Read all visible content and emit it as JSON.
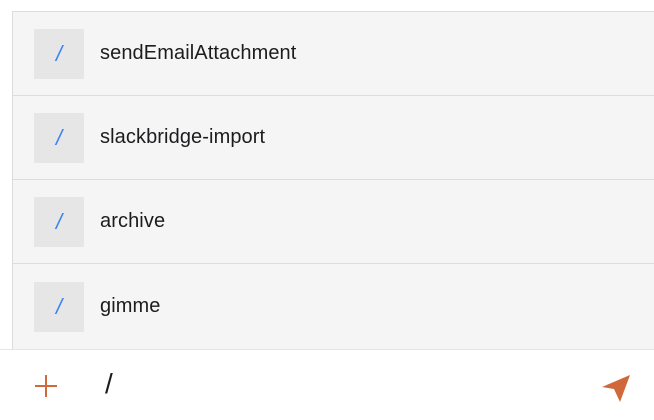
{
  "suggestions": {
    "items": [
      {
        "prefix": "/",
        "label": "sendEmailAttachment"
      },
      {
        "prefix": "/",
        "label": "slackbridge-import"
      },
      {
        "prefix": "/",
        "label": "archive"
      },
      {
        "prefix": "/",
        "label": "gimme"
      }
    ]
  },
  "composer": {
    "value": "/",
    "plus_icon": "plus-icon",
    "send_icon": "send-icon",
    "accent_color": "#d0683a"
  },
  "colors": {
    "slash": "#3b82f6",
    "list_bg": "#f5f5f5",
    "slash_box_bg": "#e6e6e6"
  }
}
